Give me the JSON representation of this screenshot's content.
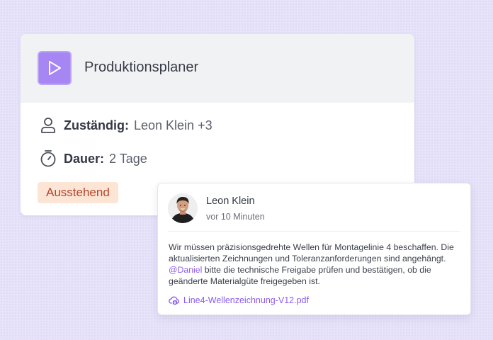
{
  "task": {
    "title": "Produktionsplaner",
    "icon": "play-icon",
    "assignee": {
      "label": "Zuständig:",
      "value": "Leon Klein +3",
      "icon": "user-icon"
    },
    "duration": {
      "label": "Dauer:",
      "value": "2 Tage",
      "icon": "stopwatch-icon"
    },
    "status": "Ausstehend"
  },
  "comment": {
    "author": "Leon Klein",
    "time": "vor 10 Minuten",
    "text_before": "Wir müssen präzisionsgedrehte Wellen für Montagelinie 4 beschaffen. Die aktualisierten Zeichnungen und Toleranzanforderungen sind angehängt. ",
    "mention": "@Daniel",
    "text_after": " bitte die technische Freigabe prüfen und bestätigen, ob die geänderte Materialgüte freigegeben ist.",
    "attachment": {
      "name": "Line4-Wellenzeichnung-V12.pdf",
      "icon": "cloud-attachment-icon"
    }
  },
  "colors": {
    "accent": "#a586f3",
    "link": "#8a5cf0",
    "status_bg": "#fde5d6",
    "status_text": "#b4442a",
    "background": "#e7e3f9"
  }
}
